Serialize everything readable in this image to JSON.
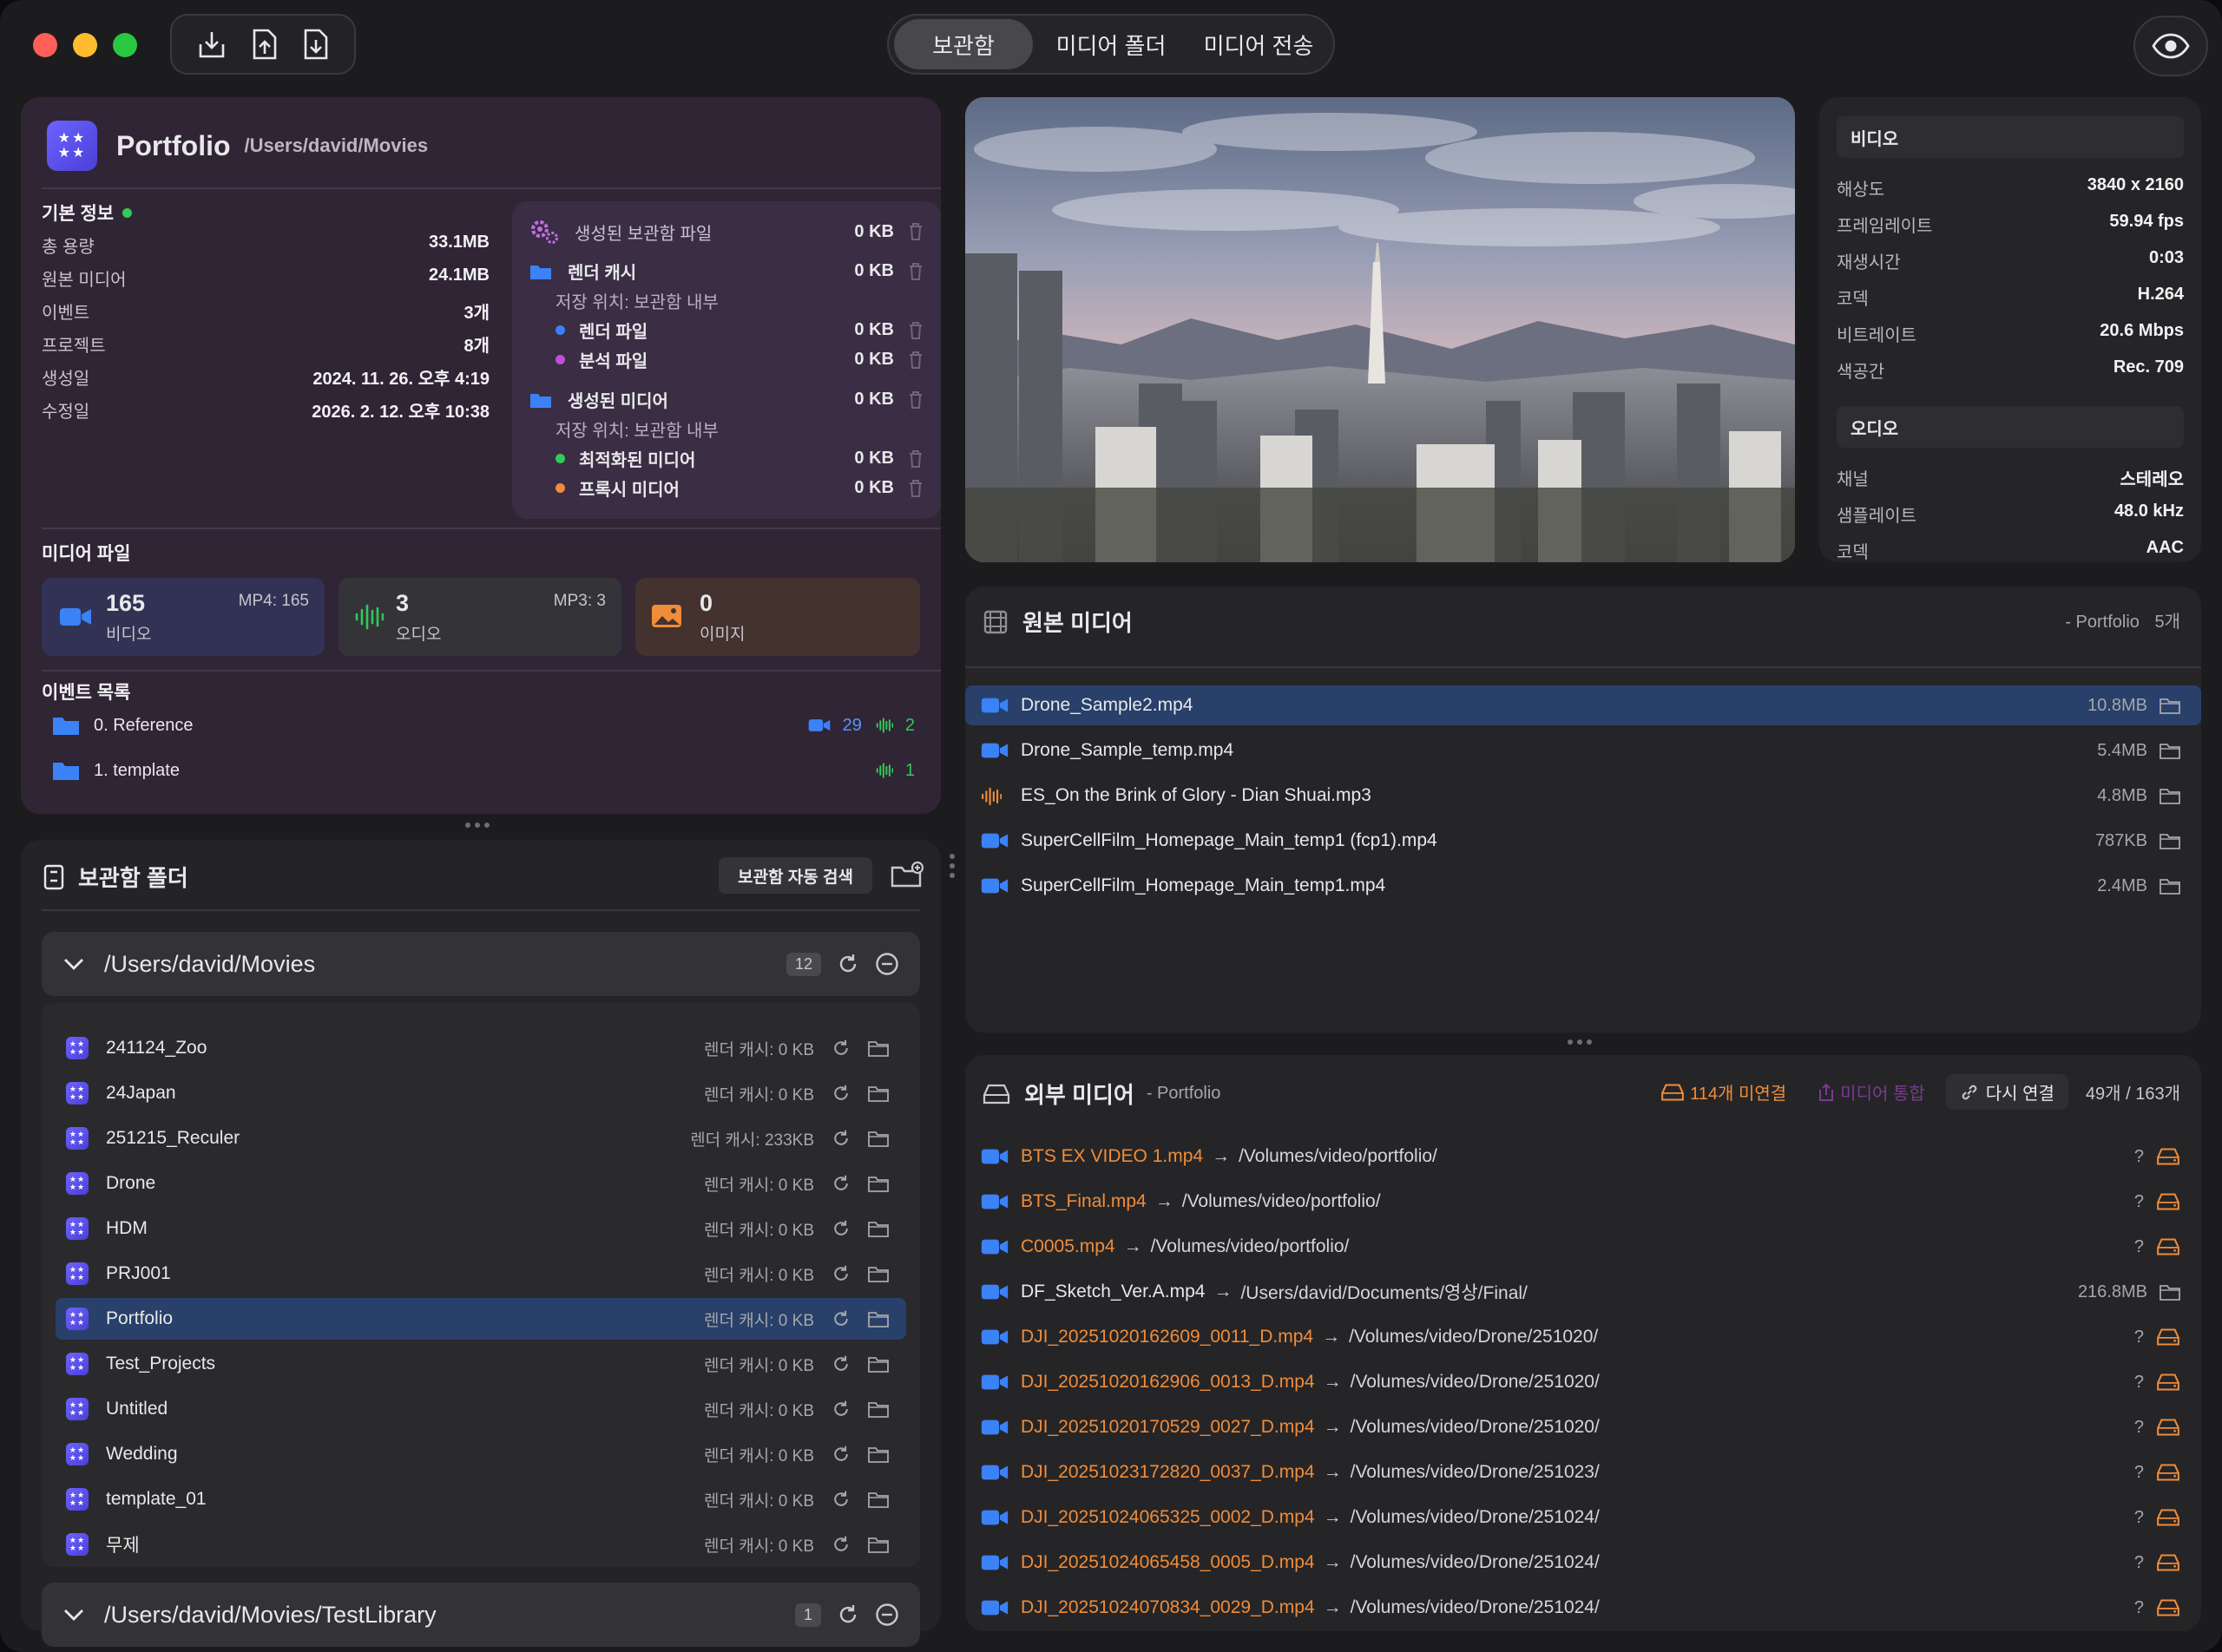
{
  "toolbar": {
    "tabs": [
      "보관함",
      "미디어 폴더",
      "미디어 전송"
    ],
    "active_tab": 0
  },
  "library": {
    "name": "Portfolio",
    "path": "/Users/david/Movies",
    "basic_info_title": "기본 정보",
    "basic_info": [
      {
        "label": "총 용량",
        "value": "33.1MB"
      },
      {
        "label": "원본 미디어",
        "value": "24.1MB"
      },
      {
        "label": "이벤트",
        "value": "3개"
      },
      {
        "label": "프로젝트",
        "value": "8개"
      },
      {
        "label": "생성일",
        "value": "2024. 11. 26. 오후 4:19"
      },
      {
        "label": "수정일",
        "value": "2026. 2. 12. 오후 10:38"
      }
    ],
    "generated": {
      "title": "생성된 보관함 파일",
      "title_size": "0 KB",
      "render_cache": "렌더 캐시",
      "render_cache_size": "0 KB",
      "render_location": "저장 위치: 보관함 내부",
      "render_files": "렌더 파일",
      "render_files_size": "0 KB",
      "analysis_files": "분석 파일",
      "analysis_files_size": "0 KB",
      "generated_media": "생성된 미디어",
      "generated_media_size": "0 KB",
      "media_location": "저장 위치: 보관함 내부",
      "optimized_media": "최적화된 미디어",
      "optimized_media_size": "0 KB",
      "proxy_media": "프록시 미디어",
      "proxy_media_size": "0 KB"
    },
    "media_files_title": "미디어 파일",
    "media_cards": [
      {
        "count": "165",
        "label": "비디오",
        "detail": "MP4: 165"
      },
      {
        "count": "3",
        "label": "오디오",
        "detail": "MP3: 3"
      },
      {
        "count": "0",
        "label": "이미지",
        "detail": ""
      }
    ],
    "events_title": "이벤트 목록",
    "events": [
      {
        "name": "0. Reference",
        "video_count": "29",
        "audio_count": "2"
      },
      {
        "name": "1. template",
        "audio_count": "1"
      }
    ]
  },
  "library_folders": {
    "title": "보관함 폴더",
    "auto_search": "보관함 자동 검색",
    "groups": [
      {
        "path": "/Users/david/Movies",
        "count": "12"
      },
      {
        "path": "/Users/david/Movies/TestLibrary",
        "count": "1"
      }
    ],
    "items": [
      {
        "name": "241124_Zoo",
        "cache": "렌더 캐시: 0 KB"
      },
      {
        "name": "24Japan",
        "cache": "렌더 캐시: 0 KB"
      },
      {
        "name": "251215_Reculer",
        "cache": "렌더 캐시: 233KB"
      },
      {
        "name": "Drone",
        "cache": "렌더 캐시: 0 KB"
      },
      {
        "name": "HDM",
        "cache": "렌더 캐시: 0 KB"
      },
      {
        "name": "PRJ001",
        "cache": "렌더 캐시: 0 KB"
      },
      {
        "name": "Portfolio",
        "cache": "렌더 캐시: 0 KB"
      },
      {
        "name": "Test_Projects",
        "cache": "렌더 캐시: 0 KB"
      },
      {
        "name": "Untitled",
        "cache": "렌더 캐시: 0 KB"
      },
      {
        "name": "Wedding",
        "cache": "렌더 캐시: 0 KB"
      },
      {
        "name": "template_01",
        "cache": "렌더 캐시: 0 KB"
      },
      {
        "name": "무제",
        "cache": "렌더 캐시: 0 KB"
      }
    ],
    "selected_index": 6
  },
  "specs": {
    "video_title": "비디오",
    "video": [
      {
        "label": "해상도",
        "value": "3840 x 2160"
      },
      {
        "label": "프레임레이트",
        "value": "59.94 fps"
      },
      {
        "label": "재생시간",
        "value": "0:03"
      },
      {
        "label": "코덱",
        "value": "H.264"
      },
      {
        "label": "비트레이트",
        "value": "20.6 Mbps"
      },
      {
        "label": "색공간",
        "value": "Rec. 709"
      }
    ],
    "audio_title": "오디오",
    "audio": [
      {
        "label": "채널",
        "value": "스테레오"
      },
      {
        "label": "샘플레이트",
        "value": "48.0 kHz"
      },
      {
        "label": "코덱",
        "value": "AAC"
      }
    ]
  },
  "original_media": {
    "title": "원본 미디어",
    "context": "- Portfolio",
    "count": "5개",
    "files": [
      {
        "name": "Drone_Sample2.mp4",
        "size": "10.8MB",
        "type": "video"
      },
      {
        "name": "Drone_Sample_temp.mp4",
        "size": "5.4MB",
        "type": "video"
      },
      {
        "name": "ES_On the Brink of Glory - Dian Shuai.mp3",
        "size": "4.8MB",
        "type": "audio"
      },
      {
        "name": "SuperCellFilm_Homepage_Main_temp1 (fcp1).mp4",
        "size": "787KB",
        "type": "video"
      },
      {
        "name": "SuperCellFilm_Homepage_Main_temp1.mp4",
        "size": "2.4MB",
        "type": "video"
      }
    ],
    "selected_index": 0
  },
  "external_media": {
    "title": "외부 미디어",
    "context": "- Portfolio",
    "unlinked": "114개 미연결",
    "consolidate": "미디어 통합",
    "relink": "다시 연결",
    "count": "49개 / 163개",
    "arrow": "→",
    "files": [
      {
        "name": "BTS EX VIDEO 1.mp4",
        "path": "/Volumes/video/portfolio/",
        "size": "?",
        "missing": true
      },
      {
        "name": "BTS_Final.mp4",
        "path": "/Volumes/video/portfolio/",
        "size": "?",
        "missing": true
      },
      {
        "name": "C0005.mp4",
        "path": "/Volumes/video/portfolio/",
        "size": "?",
        "missing": true
      },
      {
        "name": "DF_Sketch_Ver.A.mp4",
        "path": "/Users/david/Documents/영상/Final/",
        "size": "216.8MB",
        "missing": false
      },
      {
        "name": "DJI_20251020162609_0011_D.mp4",
        "path": "/Volumes/video/Drone/251020/",
        "size": "?",
        "missing": true
      },
      {
        "name": "DJI_20251020162906_0013_D.mp4",
        "path": "/Volumes/video/Drone/251020/",
        "size": "?",
        "missing": true
      },
      {
        "name": "DJI_20251020170529_0027_D.mp4",
        "path": "/Volumes/video/Drone/251020/",
        "size": "?",
        "missing": true
      },
      {
        "name": "DJI_20251023172820_0037_D.mp4",
        "path": "/Volumes/video/Drone/251023/",
        "size": "?",
        "missing": true
      },
      {
        "name": "DJI_20251024065325_0002_D.mp4",
        "path": "/Volumes/video/Drone/251024/",
        "size": "?",
        "missing": true
      },
      {
        "name": "DJI_20251024065458_0005_D.mp4",
        "path": "/Volumes/video/Drone/251024/",
        "size": "?",
        "missing": true
      },
      {
        "name": "DJI_20251024070834_0029_D.mp4",
        "path": "/Volumes/video/Drone/251024/",
        "size": "?",
        "missing": true
      }
    ]
  },
  "colors": {
    "accent_blue": "#3b82f6",
    "selection": "#28406a",
    "missing_orange": "#f08c3a",
    "ok_green": "#34c759"
  }
}
